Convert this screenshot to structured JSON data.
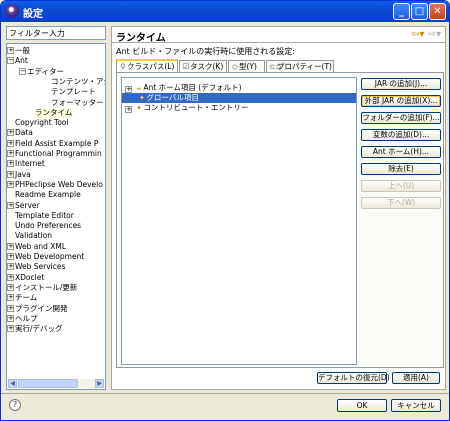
{
  "window": {
    "title": "設定",
    "minimize": "_",
    "maximize": "□",
    "close": "✕"
  },
  "filter": {
    "value": "フィルター入力"
  },
  "tree": [
    {
      "label": "一般",
      "exp": "+"
    },
    {
      "label": "Ant",
      "exp": "−"
    },
    {
      "label": "エディター",
      "exp": "−"
    },
    {
      "label": "コンテンツ・アシスト"
    },
    {
      "label": "テンプレート"
    },
    {
      "label": "フォーマッター"
    },
    {
      "label": "ランタイム"
    },
    {
      "label": "Copyright Tool"
    },
    {
      "label": "Data",
      "exp": "+"
    },
    {
      "label": "Field Assist Example P",
      "exp": "+"
    },
    {
      "label": "Functional Programmin",
      "exp": "+"
    },
    {
      "label": "Internet",
      "exp": "+"
    },
    {
      "label": "Java",
      "exp": "+"
    },
    {
      "label": "PHPeclipse Web Develo",
      "exp": "+"
    },
    {
      "label": "Readme Example"
    },
    {
      "label": "Server",
      "exp": "+"
    },
    {
      "label": "Template Editor"
    },
    {
      "label": "Undo Preferences"
    },
    {
      "label": "Validation"
    },
    {
      "label": "Web and XML",
      "exp": "+"
    },
    {
      "label": "Web Development",
      "exp": "+"
    },
    {
      "label": "Web Services",
      "exp": "+"
    },
    {
      "label": "XDoclet",
      "exp": "+"
    },
    {
      "label": "インストール/更新",
      "exp": "+"
    },
    {
      "label": "チーム",
      "exp": "+"
    },
    {
      "label": "プラグイン開発",
      "exp": "+"
    },
    {
      "label": "ヘルプ",
      "exp": "+"
    },
    {
      "label": "実行/デバッグ",
      "exp": "+"
    }
  ],
  "page": {
    "title": "ランタイム",
    "description": "Ant ビルド・ファイルの実行時に使用される設定:",
    "tabs": [
      "クラスパス(L)",
      "タスク(K)",
      "型(Y)",
      "プロパティー(T)"
    ],
    "classpath": [
      "Ant ホーム項目 (デフォルト)",
      "グローバル項目",
      "コントリビュート・エントリー"
    ],
    "buttons": {
      "add_jar": "JAR の追加(J)...",
      "add_ext_jar": "外部 JAR の追加(X)...",
      "add_folder": "フォルダーの追加(F)...",
      "add_var": "変数の追加(D)...",
      "ant_home": "Ant ホーム(H)...",
      "remove": "除去(E)",
      "up": "上へ(U)",
      "down": "下へ(W)"
    },
    "restore_defaults": "デフォルトの復元(D)",
    "apply": "適用(A)"
  },
  "footer": {
    "help": "?",
    "ok": "OK",
    "cancel": "キャンセル"
  }
}
